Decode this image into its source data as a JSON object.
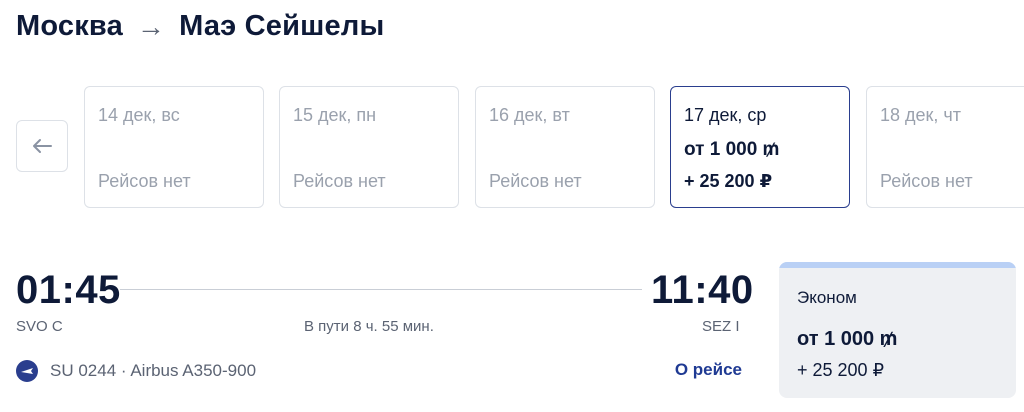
{
  "header": {
    "from": "Москва",
    "arrow": "→",
    "to": "Маэ Сейшелы"
  },
  "dates": [
    {
      "date": "14 дек, вс",
      "status": "Рейсов нет"
    },
    {
      "date": "15 дек, пн",
      "status": "Рейсов нет"
    },
    {
      "date": "16 дек, вт",
      "status": "Рейсов нет"
    },
    {
      "date": "17 дек, ср",
      "price": "от 1 000 ₥",
      "add": "+ 25 200 ₽",
      "selected": true
    },
    {
      "date": "18 дек, чт",
      "status": "Рейсов нет"
    }
  ],
  "flight": {
    "depart_time": "01:45",
    "arrive_time": "11:40",
    "depart_code": "SVO C",
    "arrive_code": "SEZ I",
    "duration": "В пути 8 ч. 55 мин.",
    "number_aircraft": "SU 0244 · Airbus A350-900",
    "about_link": "О рейсе"
  },
  "fare": {
    "class": "Эконом",
    "price": "от 1 000 ₥",
    "add": "+ 25 200 ₽"
  },
  "colors": {
    "primary": "#2a3e8e",
    "text": "#0e1a38",
    "muted": "#9aa1ad",
    "fare_bg": "#eef0f3",
    "fare_bar": "#b9d0f5"
  }
}
